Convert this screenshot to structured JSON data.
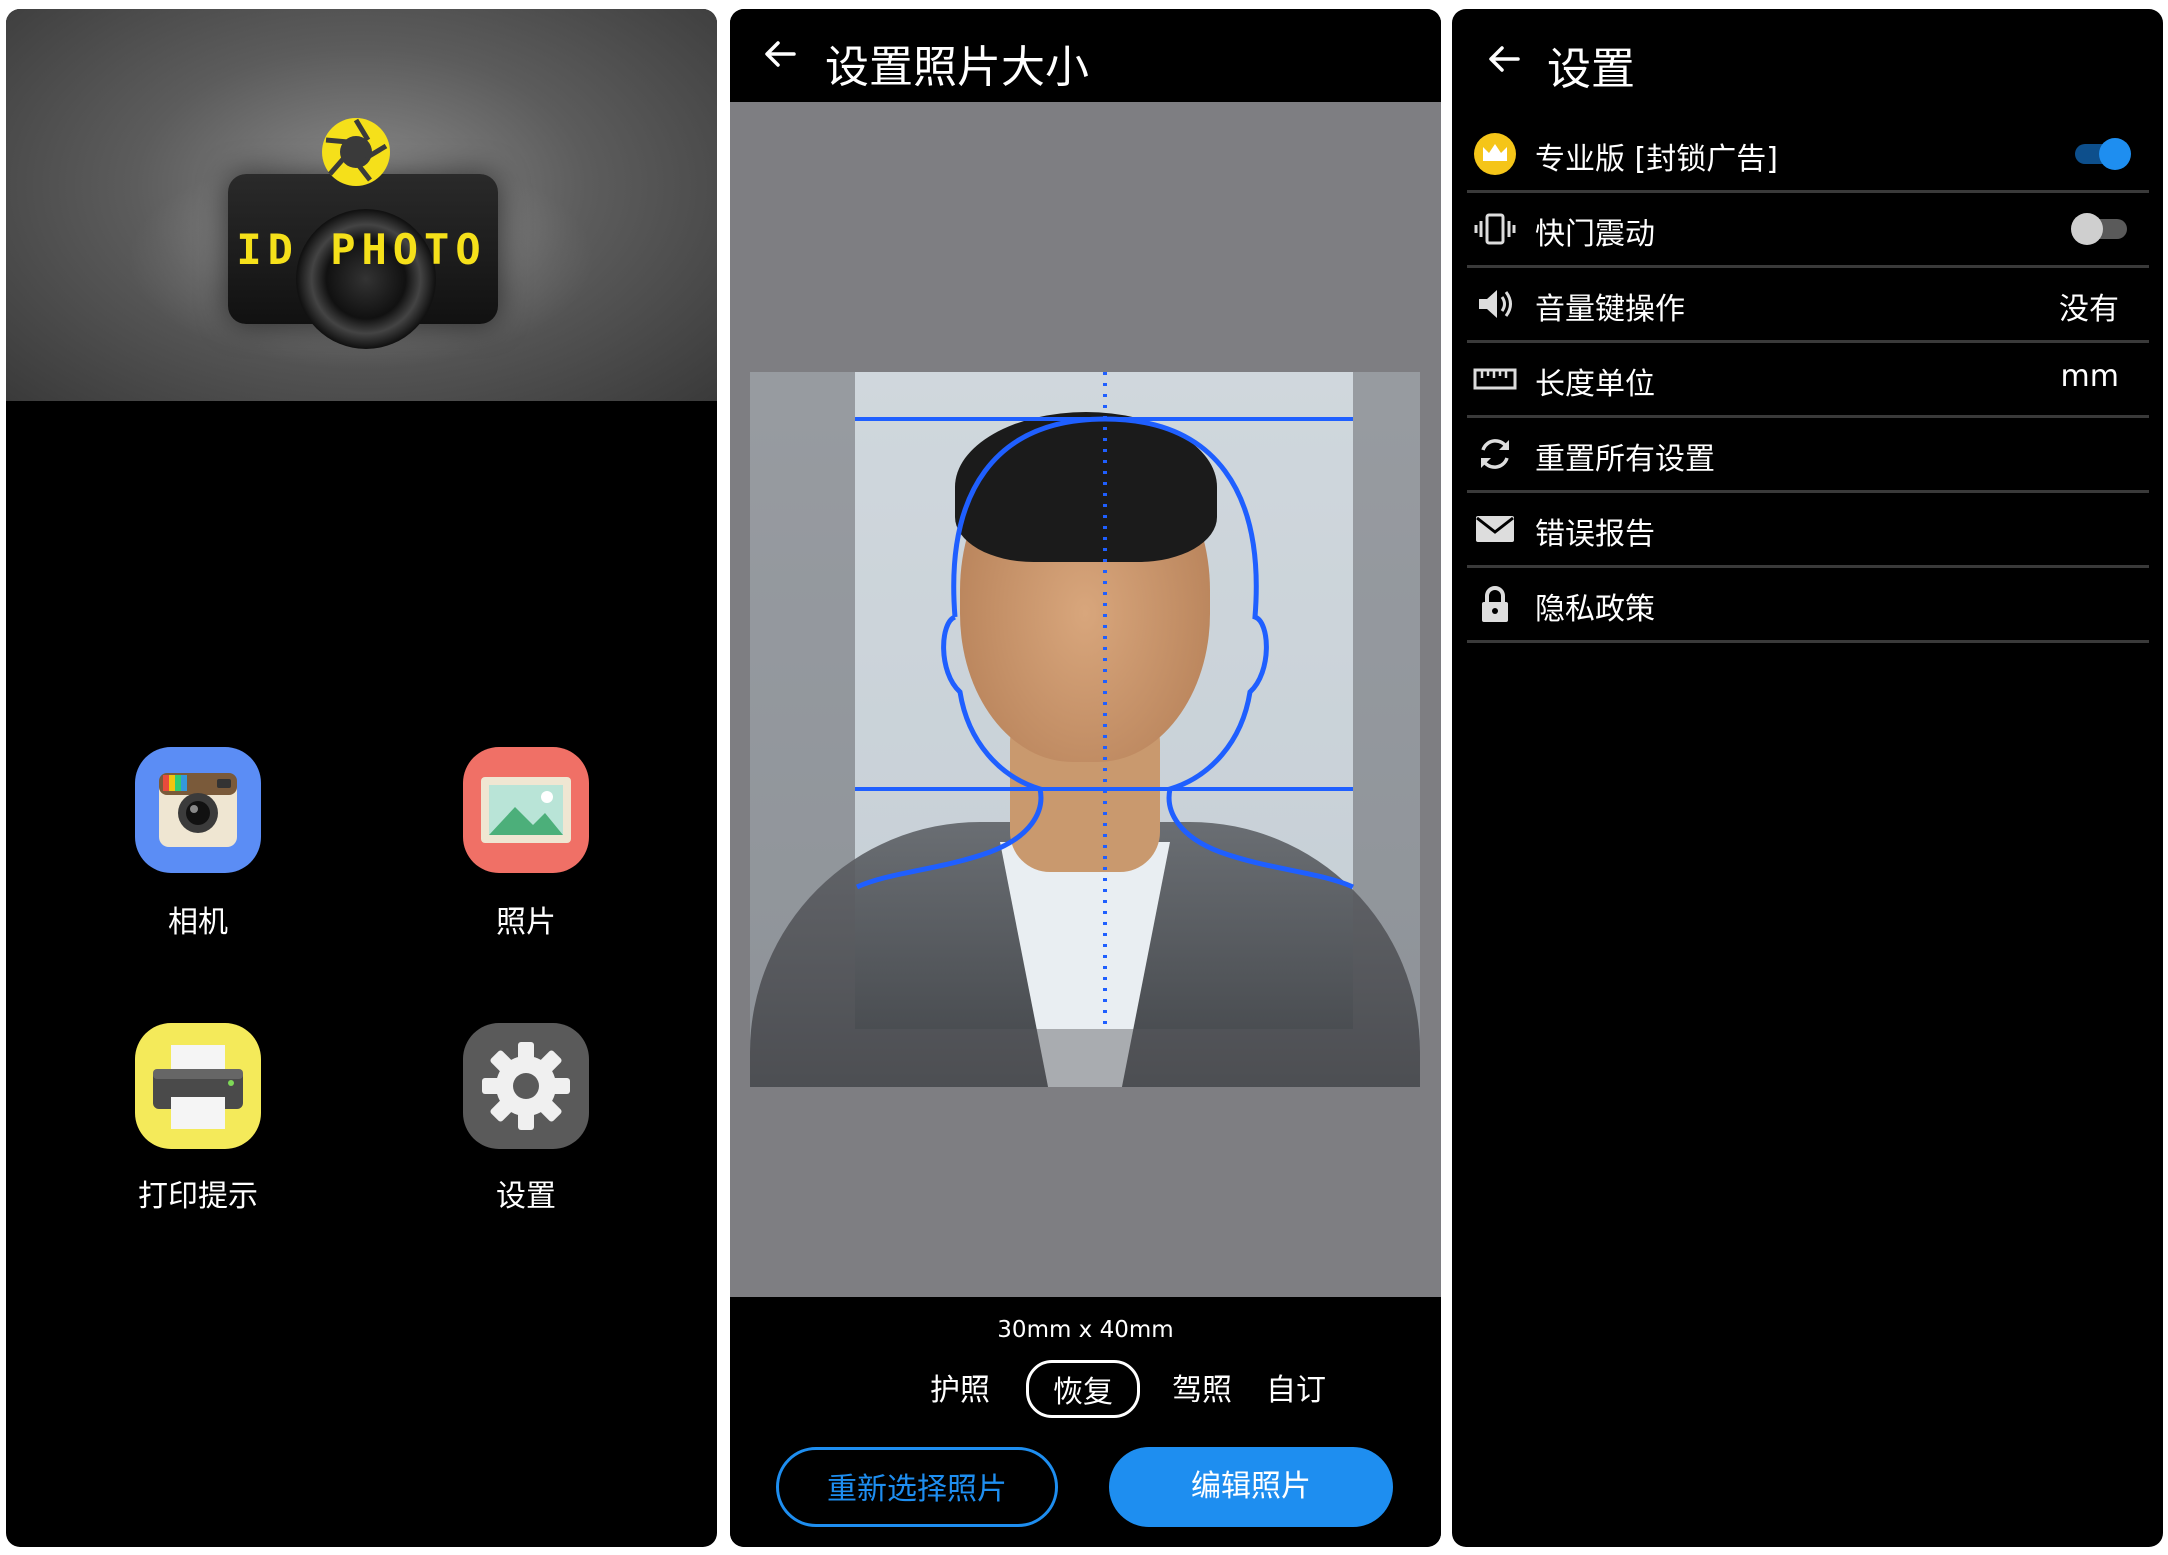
{
  "colors": {
    "accent": "#1e8ef0",
    "brand_yellow": "#f5e01a",
    "stage_gray": "#7e7e82",
    "divider": "#3a3a3a"
  },
  "home": {
    "brand": "ID PHOTO",
    "tiles": [
      {
        "label": "相机",
        "icon": "camera-icon"
      },
      {
        "label": "照片",
        "icon": "gallery-icon"
      },
      {
        "label": "打印提示",
        "icon": "printer-icon"
      },
      {
        "label": "设置",
        "icon": "gear-icon"
      }
    ]
  },
  "editor": {
    "title": "设置照片大小",
    "size": "30mm x 40mm",
    "options": [
      "护照",
      "恢复",
      "驾照",
      "自订"
    ],
    "selected_option": "恢复",
    "reselect_label": "重新选择照片",
    "edit_label": "编辑照片"
  },
  "settings": {
    "title": "设置",
    "items": [
      {
        "icon": "crown-icon",
        "label": "专业版 [封锁广告]",
        "toggle": true
      },
      {
        "icon": "vibrate-icon",
        "label": "快门震动",
        "toggle": false
      },
      {
        "icon": "volume-icon",
        "label": "音量键操作",
        "value": "没有"
      },
      {
        "icon": "ruler-icon",
        "label": "长度单位",
        "value": "mm"
      },
      {
        "icon": "reset-icon",
        "label": "重置所有设置"
      },
      {
        "icon": "mail-icon",
        "label": "错误报告"
      },
      {
        "icon": "lock-icon",
        "label": "隐私政策"
      }
    ]
  }
}
